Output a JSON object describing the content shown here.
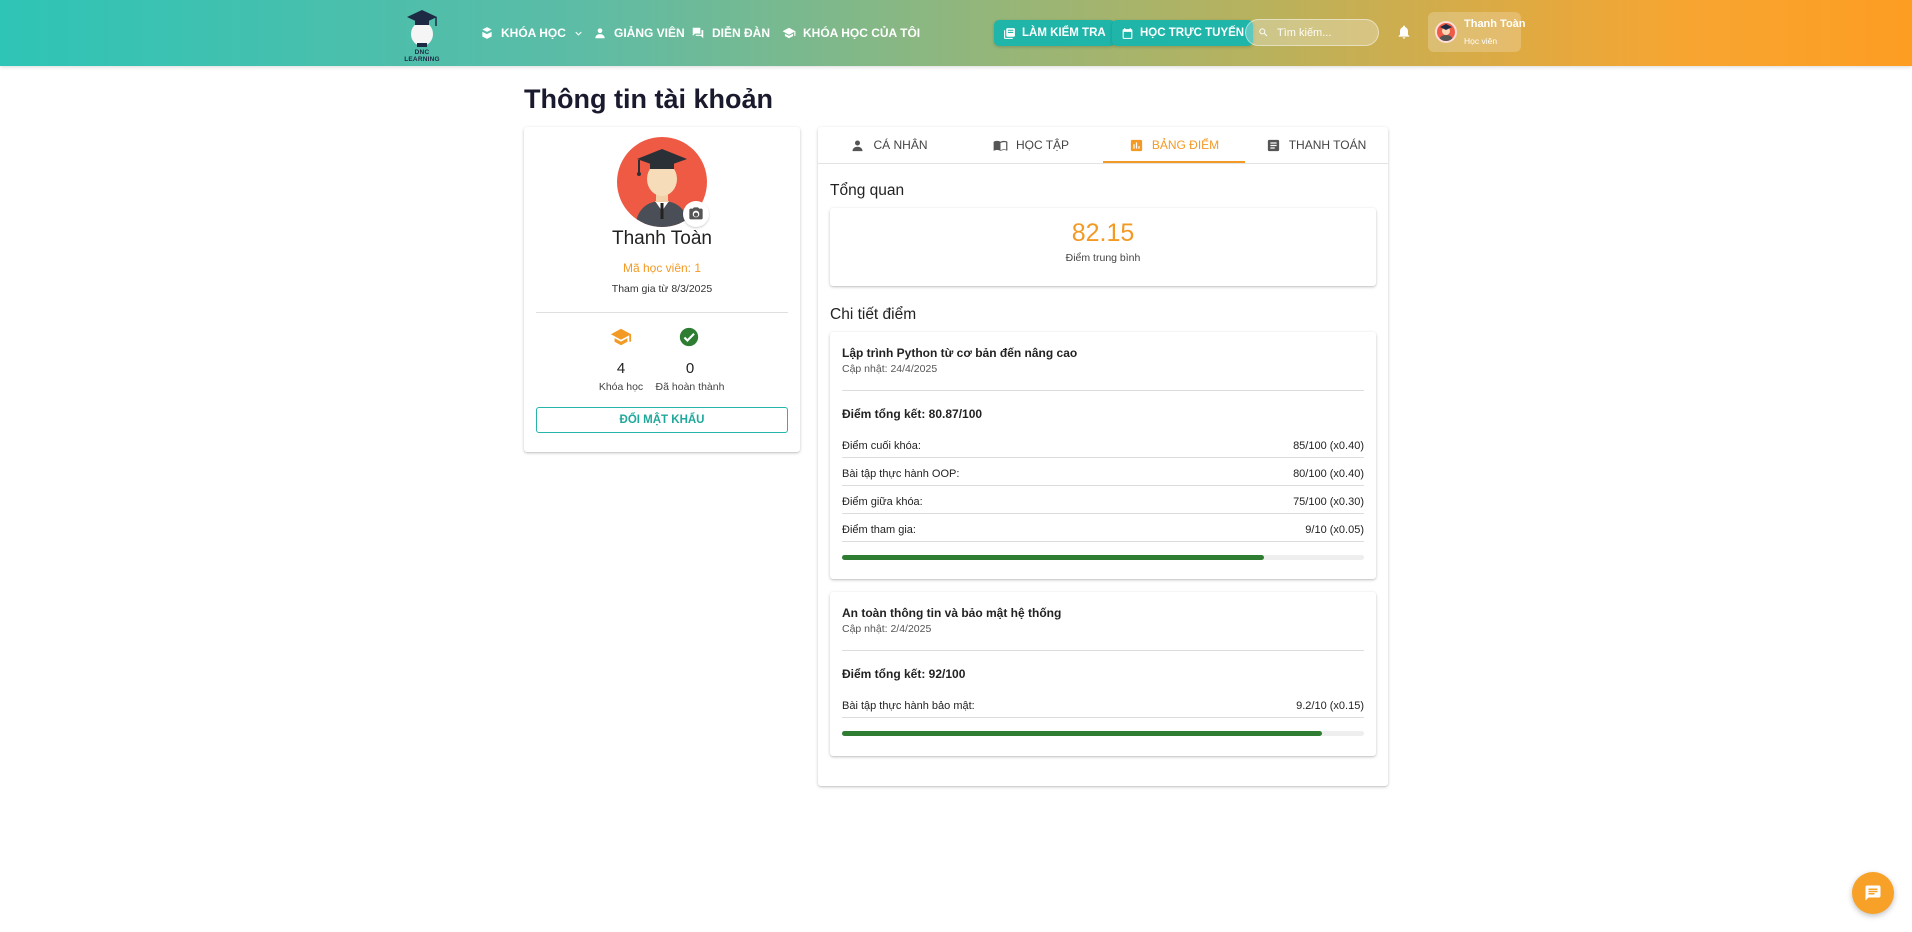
{
  "header": {
    "brand": "DNC LEARNING",
    "nav": [
      {
        "label": "KHÓA HỌC",
        "icon": "book-stack-icon",
        "has_dropdown": true
      },
      {
        "label": "GIẢNG VIÊN",
        "icon": "person-icon"
      },
      {
        "label": "DIỄN ĐÀN",
        "icon": "forum-icon"
      },
      {
        "label": "KHÓA HỌC CỦA TÔI",
        "icon": "graduation-cap-icon"
      }
    ],
    "actions": [
      {
        "label": "LÀM KIỂM TRA",
        "icon": "quiz-icon"
      },
      {
        "label": "HỌC TRỰC TUYẾN",
        "icon": "calendar-icon"
      }
    ],
    "search_placeholder": "Tìm kiếm...",
    "user": {
      "name": "Thanh Toàn",
      "role": "Học viên"
    }
  },
  "page": {
    "title": "Thông tin tài khoản"
  },
  "profile": {
    "name": "Thanh Toàn",
    "student_id": "Mã học viên: 1",
    "joined": "Tham gia từ 8/3/2025",
    "stats": [
      {
        "value": "4",
        "label": "Khóa học",
        "icon": "graduation-cap-icon",
        "color": "#f39a25"
      },
      {
        "value": "0",
        "label": "Đã hoàn thành",
        "icon": "check-circle-icon",
        "color": "#2e7d32"
      }
    ],
    "change_password": "ĐỔI MẬT KHẨU"
  },
  "tabs": [
    {
      "label": "CÁ NHÂN",
      "icon": "person-icon"
    },
    {
      "label": "HỌC TẬP",
      "icon": "open-book-icon"
    },
    {
      "label": "BẢNG ĐIỂM",
      "icon": "bar-chart-icon",
      "active": true
    },
    {
      "label": "THANH TOÁN",
      "icon": "receipt-icon"
    }
  ],
  "overview": {
    "title": "Tổng quan",
    "average": "82.15",
    "average_label": "Điểm trung bình"
  },
  "details": {
    "title": "Chi tiết điểm",
    "courses": [
      {
        "name": "Lập trình Python từ cơ bản đến nâng cao",
        "updated": "Cập nhật: 24/4/2025",
        "total": "Điểm tổng kết: 80.87/100",
        "progress": 0.8087,
        "items": [
          {
            "label": "Điểm cuối khóa:",
            "value": "85/100 (x0.40)"
          },
          {
            "label": "Bài tập thực hành OOP:",
            "value": "80/100 (x0.40)"
          },
          {
            "label": "Điểm giữa khóa:",
            "value": "75/100 (x0.30)"
          },
          {
            "label": "Điểm tham gia:",
            "value": "9/10 (x0.05)"
          }
        ]
      },
      {
        "name": "An toàn thông tin và bảo mật hệ thống",
        "updated": "Cập nhật: 2/4/2025",
        "total": "Điểm tổng kết: 92/100",
        "progress": 0.92,
        "items": [
          {
            "label": "Bài tập thực hành bảo mật:",
            "value": "9.2/10 (x0.15)"
          }
        ]
      }
    ]
  },
  "colors": {
    "accent": "#f39a25",
    "teal": "#1fb5a9",
    "progress": "#2e7d32"
  }
}
